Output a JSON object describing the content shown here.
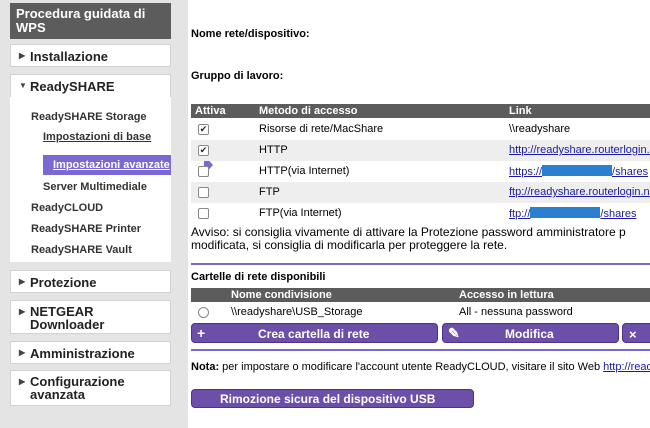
{
  "sidebar": {
    "header": "Procedura guidata di WPS",
    "sections": {
      "installazione": "Installazione",
      "readyshare": "ReadySHARE",
      "protezione": "Protezione",
      "netgear_downloader": "NETGEAR Downloader",
      "amministrazione": "Amministrazione",
      "configurazione_avanzata": "Configurazione avanzata"
    },
    "readyshare_items": {
      "storage": "ReadySHARE Storage",
      "impostazioni_base": "Impostazioni di base",
      "impostazioni_avanzate": "Impostazioni avanzate",
      "server_multimediale": "Server Multimediale",
      "readycloud": "ReadyCLOUD",
      "printer": "ReadySHARE Printer",
      "vault": "ReadySHARE Vault"
    }
  },
  "main": {
    "device_name_label": "Nome rete/dispositivo:",
    "workgroup_label": "Gruppo di lavoro:",
    "access_table": {
      "headers": {
        "active": "Attiva",
        "method": "Metodo di accesso",
        "link": "Link"
      },
      "rows": [
        {
          "checked": true,
          "method": "Risorse di rete/MacShare",
          "link": "\\\\readyshare"
        },
        {
          "checked": true,
          "method": "HTTP",
          "link": "http://readyshare.routerlogin.n"
        },
        {
          "checked": false,
          "method": "HTTP(via Internet)",
          "link_prefix": "https://",
          "link_suffix": "/shares"
        },
        {
          "checked": false,
          "method": "FTP",
          "link": "ftp://readyshare.routerlogin.ne"
        },
        {
          "checked": false,
          "method": "FTP(via Internet)",
          "link_prefix": "ftp://",
          "link_suffix": "/shares"
        }
      ]
    },
    "warning_line1": "Avviso: si consiglia vivamente di attivare la Protezione password amministratore p",
    "warning_line2": "modificata, si consiglia di modificarla per proteggere la rete.",
    "folders": {
      "title": "Cartelle di rete disponibili",
      "headers": {
        "share_name": "Nome condivisione",
        "read_access": "Accesso in lettura"
      },
      "rows": [
        {
          "share_name": "\\\\readyshare\\USB_Storage",
          "read_access": "All - nessuna password"
        }
      ]
    },
    "buttons": {
      "create": "Crea cartella di rete",
      "edit": "Modifica",
      "delete_icon": "×",
      "remove_usb": "Rimozione sicura del dispositivo USB"
    },
    "note_prefix": "Nota:",
    "note_text": " per impostare o modificare l'account utente ReadyCLOUD, visitare il sito Web ",
    "note_link": "http://ready"
  },
  "colors": {
    "accent": "#7b68d2",
    "button": "#6b4fa8",
    "header_gray": "#5c5c5c",
    "link": "#1a1aa6",
    "mask": "#2a7fd1"
  }
}
